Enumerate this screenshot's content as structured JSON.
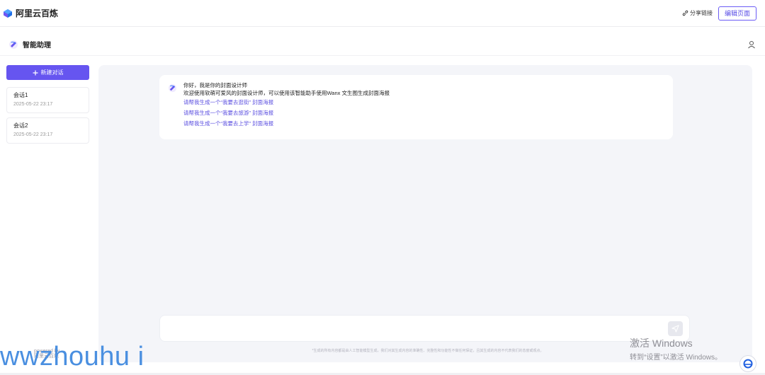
{
  "topbar": {
    "brand": "阿里云百炼",
    "share_label": "分享链接",
    "edit_label": "编辑页面"
  },
  "app": {
    "title": "智能助理"
  },
  "sidebar": {
    "new_chat_label": "新建对话",
    "sessions": [
      {
        "name": "会话1",
        "time": "2025-05-22 23:17"
      },
      {
        "name": "会话2",
        "time": "2025-05-22 23:17"
      }
    ],
    "powered_by": "powered by",
    "powered_brand": "阿里云百炼"
  },
  "chat": {
    "greeting": "你好，我是你的封面设计师",
    "intro": "欢迎使用软萌可爱风的封面设计师，可以使用该智能助手使用Wanx 文生图生成封面海报",
    "suggestions": [
      "请帮我生成一个“我要去逛街” 封面海报",
      "请帮我生成一个“我要去旅游” 封面海报",
      "请帮我生成一个“我要去上学” 封面海报"
    ],
    "input_placeholder": "",
    "disclaimer": "*生成的所有内容都是由人工智能模型生成，我们对其生成内容的准确性、完整性和功能性不做任何保证，且其生成的内容不代表我们的态度或观点。"
  },
  "overlay": {
    "watermark": "wwzhouhu i",
    "activate_title": "激活 Windows",
    "activate_sub": "转到“设置”以激活 Windows。"
  },
  "colors": {
    "accent": "#6655f0",
    "link": "#5b4fe0",
    "panel_bg": "#f4f5f9"
  }
}
